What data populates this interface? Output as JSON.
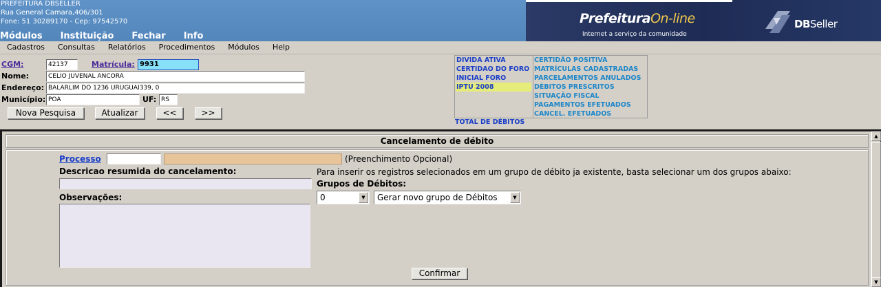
{
  "header": {
    "org_name": "PREFEITURA DBSELLER",
    "address": "Rua General Camara,406/301",
    "phone": "Fone: 51 30289170  -  Cep: 97542570",
    "top_menu": [
      "Módulos",
      "Instituição",
      "Fechar",
      "Info"
    ],
    "logo_prefeitura": "Prefeitura",
    "logo_online": "On-line",
    "logo_tagline": "Internet a serviço da comunidade",
    "logo_dbseller_bold": "DB",
    "logo_dbseller_regular": "Seller"
  },
  "menubar": [
    "Cadastros",
    "Consultas",
    "Relatórios",
    "Procedimentos",
    "Módulos",
    "Help"
  ],
  "info": {
    "cgm_label": "CGM:",
    "cgm_value": "42137",
    "matricula_label": "Matrícula:",
    "matricula_value": "9931",
    "nome_label": "Nome:",
    "nome_value": "CELIO JUVENAL ANCORA",
    "endereco_label": "Endereço:",
    "endereco_value": "BALARLIM DO 1236 URUGUAI339, 0",
    "municipio_label": "Município:",
    "municipio_value": "POA",
    "uf_label": "UF:",
    "uf_value": "RS",
    "buttons": {
      "nova_pesquisa": "Nova Pesquisa",
      "atualizar": "Atualizar",
      "prev": "<<",
      "next": ">>"
    }
  },
  "debitos": {
    "left": [
      "DIVIDA ATIVA",
      "CERTIDAO DO FORO",
      "INICIAL FORO",
      "IPTU 2008"
    ],
    "selected_index": 3,
    "right": [
      "CERTIDÃO POSITIVA",
      "MATRÍCULAS CADASTRADAS",
      "PARCELAMENTOS ANULADOS",
      "DÉBITOS PRESCRITOS",
      "SITUAÇÃO FISCAL",
      "PAGAMENTOS EFETUADOS",
      "CANCEL. EFETUADOS"
    ],
    "total": "TOTAL DE DÉBITOS"
  },
  "panel": {
    "title": "Cancelamento de débito",
    "processo_label": "Processo",
    "processo_value": "",
    "preenchimento": "(Preenchimento Opcional)",
    "descricao_label": "Descricao resumida do cancelamento:",
    "descricao_value": "",
    "observacoes_label": "Observações:",
    "observacoes_value": "",
    "hint": "Para inserir os registros selecionados em um grupo de débito ja existente, basta selecionar um dos grupos abaixo:",
    "grupos_label": "Grupos de Débitos:",
    "grupo_number_value": "0",
    "grupo_select_value": "Gerar novo grupo de Débitos",
    "confirmar": "Confirmar"
  },
  "colors": {
    "header_blue": "#5b8fc4",
    "banner_dark": "#1e2c55",
    "link_purple": "#4b2b9b",
    "debit_blue": "#1a3ec8",
    "debit_teal": "#1e86c8",
    "selected_yellow": "#e6ec7a",
    "matricula_field": "#86e0f8",
    "processo_desc_field": "#e8c49a",
    "textarea_lavender": "#e9e6f2"
  }
}
